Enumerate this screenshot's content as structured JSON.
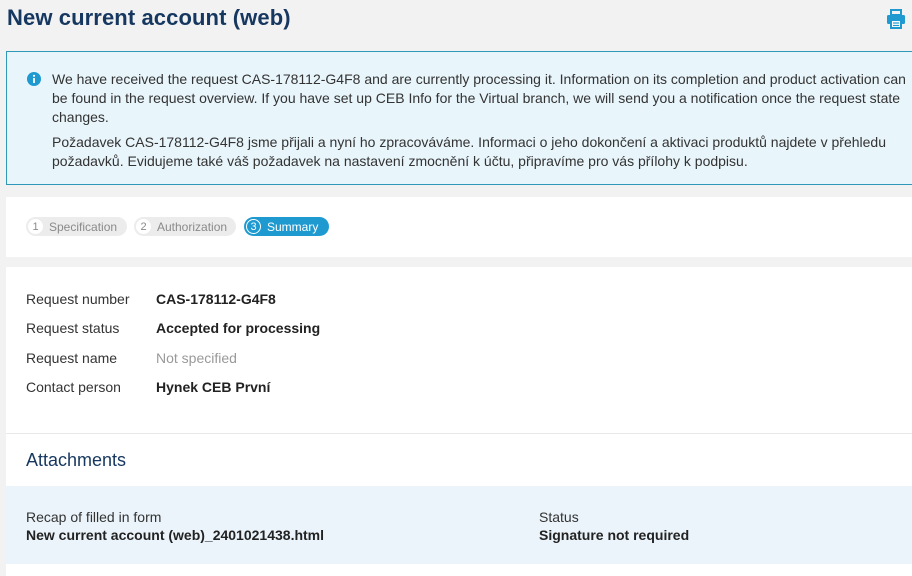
{
  "header": {
    "title": "New current account (web)",
    "print_icon": "printer-icon"
  },
  "info": {
    "icon": "info-icon",
    "paragraph_en": "We have received the request CAS-178112-G4F8 and are currently processing it. Information on its completion and product activation can be found in the request overview. If you have set up CEB Info for the Virtual branch, we will send you a notification once the request state changes.",
    "paragraph_cz": "Požadavek CAS-178112-G4F8 jsme přijali a nyní ho zpracováváme. Informaci o jeho dokončení a aktivaci produktů najdete v přehledu požadavků. Evidujeme také váš požadavek na nastavení zmocnění k účtu, připravíme pro vás přílohy k podpisu."
  },
  "steps": [
    {
      "number": "1",
      "label": "Specification"
    },
    {
      "number": "2",
      "label": "Authorization"
    },
    {
      "number": "3",
      "label": "Summary"
    }
  ],
  "details": {
    "request_number_label": "Request number",
    "request_number": "CAS-178112-G4F8",
    "request_status_label": "Request status",
    "request_status": "Accepted for processing",
    "request_name_label": "Request name",
    "request_name": "Not specified",
    "contact_person_label": "Contact person",
    "contact_person": "Hynek CEB První"
  },
  "attachments": {
    "title": "Attachments",
    "recap_label": "Recap of filled in form",
    "recap_file": "New current account (web)_2401021438.html",
    "status_label": "Status",
    "status_value": "Signature not required"
  },
  "colors": {
    "title": "#16375f",
    "accent": "#1e9ad1",
    "info_border": "#2f98b8",
    "info_bg": "#e8f5fb"
  }
}
